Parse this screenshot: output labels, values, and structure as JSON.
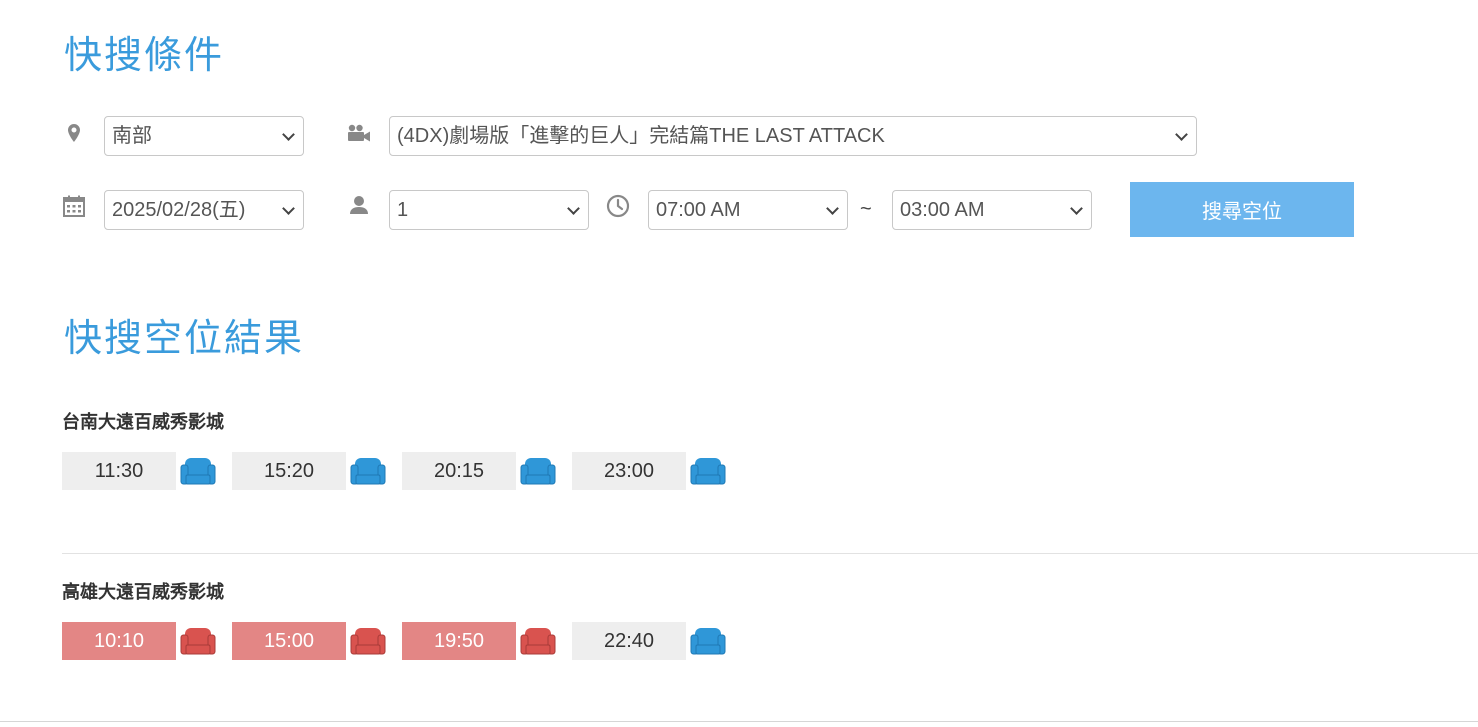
{
  "search": {
    "title": "快搜條件",
    "region": "南部",
    "movie": "(4DX)劇場版「進擊的巨人」完結篇THE LAST ATTACK",
    "date": "2025/02/28(五)",
    "tickets": "1",
    "time_from": "07:00 AM",
    "time_sep": "~",
    "time_to": "03:00 AM",
    "button_label": "搜尋空位"
  },
  "results": {
    "title": "快搜空位結果",
    "cinemas": [
      {
        "name": "台南大遠百威秀影城",
        "showtimes": [
          {
            "time": "11:30",
            "status": "available"
          },
          {
            "time": "15:20",
            "status": "available"
          },
          {
            "time": "20:15",
            "status": "available"
          },
          {
            "time": "23:00",
            "status": "available"
          }
        ]
      },
      {
        "name": "高雄大遠百威秀影城",
        "showtimes": [
          {
            "time": "10:10",
            "status": "full"
          },
          {
            "time": "15:00",
            "status": "full"
          },
          {
            "time": "19:50",
            "status": "full"
          },
          {
            "time": "22:40",
            "status": "available"
          }
        ]
      }
    ]
  },
  "colors": {
    "accent": "#3a9bdc",
    "button": "#6cb6ee",
    "available_seat": "#2f97d8",
    "full_seat": "#d9534f",
    "full_slot": "#e38685"
  },
  "icons": [
    "map-pin-icon",
    "movie-camera-icon",
    "calendar-icon",
    "person-icon",
    "clock-icon",
    "seat-icon"
  ]
}
